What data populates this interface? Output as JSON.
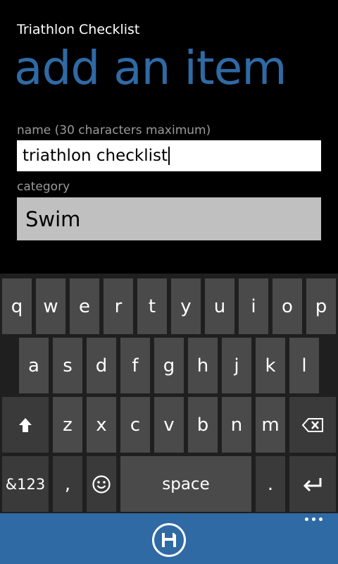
{
  "header": {
    "app_title": "Triathlon Checklist",
    "page_title": "add an item"
  },
  "form": {
    "name_label": "name (30 characters maximum)",
    "name_value": "triathlon checklist",
    "category_label": "category",
    "category_value": "Swim"
  },
  "keyboard": {
    "row1": [
      "q",
      "w",
      "e",
      "r",
      "t",
      "y",
      "u",
      "i",
      "o",
      "p"
    ],
    "row2": [
      "a",
      "s",
      "d",
      "f",
      "g",
      "h",
      "j",
      "k",
      "l"
    ],
    "row3": [
      "z",
      "x",
      "c",
      "v",
      "b",
      "n",
      "m"
    ],
    "numbers_key": "&123",
    "comma_key": ",",
    "space_key": "space",
    "period_key": "."
  },
  "appbar": {
    "save_icon": "save-icon",
    "more_icon": "more-icon"
  },
  "colors": {
    "accent": "#2f6aa5",
    "background": "#000000",
    "keyboard_key": "#4a4a4a"
  }
}
